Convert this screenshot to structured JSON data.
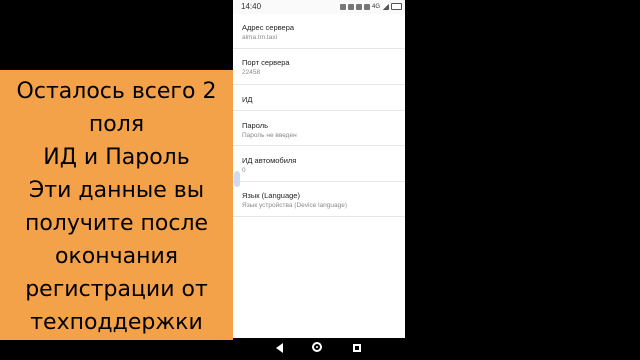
{
  "callout": {
    "lines": [
      "Осталось всего 2",
      "поля",
      "ИД и Пароль",
      "Эти данные вы",
      "получите после",
      "окончания",
      "регистрации от",
      "техподдержки"
    ],
    "bg_color": "#f4a24a"
  },
  "status_bar": {
    "time": "14:40",
    "icons": [
      "image-icon",
      "settings-icon",
      "alarm-icon",
      "wifi-icon",
      "4g-icon",
      "signal-icon",
      "battery-icon"
    ],
    "network_label": "4G"
  },
  "settings": [
    {
      "title": "Адрес сервера",
      "subtitle": "alma.tm.taxi"
    },
    {
      "title": "Порт сервера",
      "subtitle": "22458"
    },
    {
      "title": "ИД",
      "subtitle": ""
    },
    {
      "title": "Пароль",
      "subtitle": "Пароль не введен"
    },
    {
      "title": "ИД автомобиля",
      "subtitle": "0"
    },
    {
      "title": "Язык (Language)",
      "subtitle": "Язык устройства (Device language)"
    }
  ],
  "nav_bar": {
    "icons": [
      "back-icon",
      "home-icon",
      "recent-apps-icon"
    ]
  }
}
